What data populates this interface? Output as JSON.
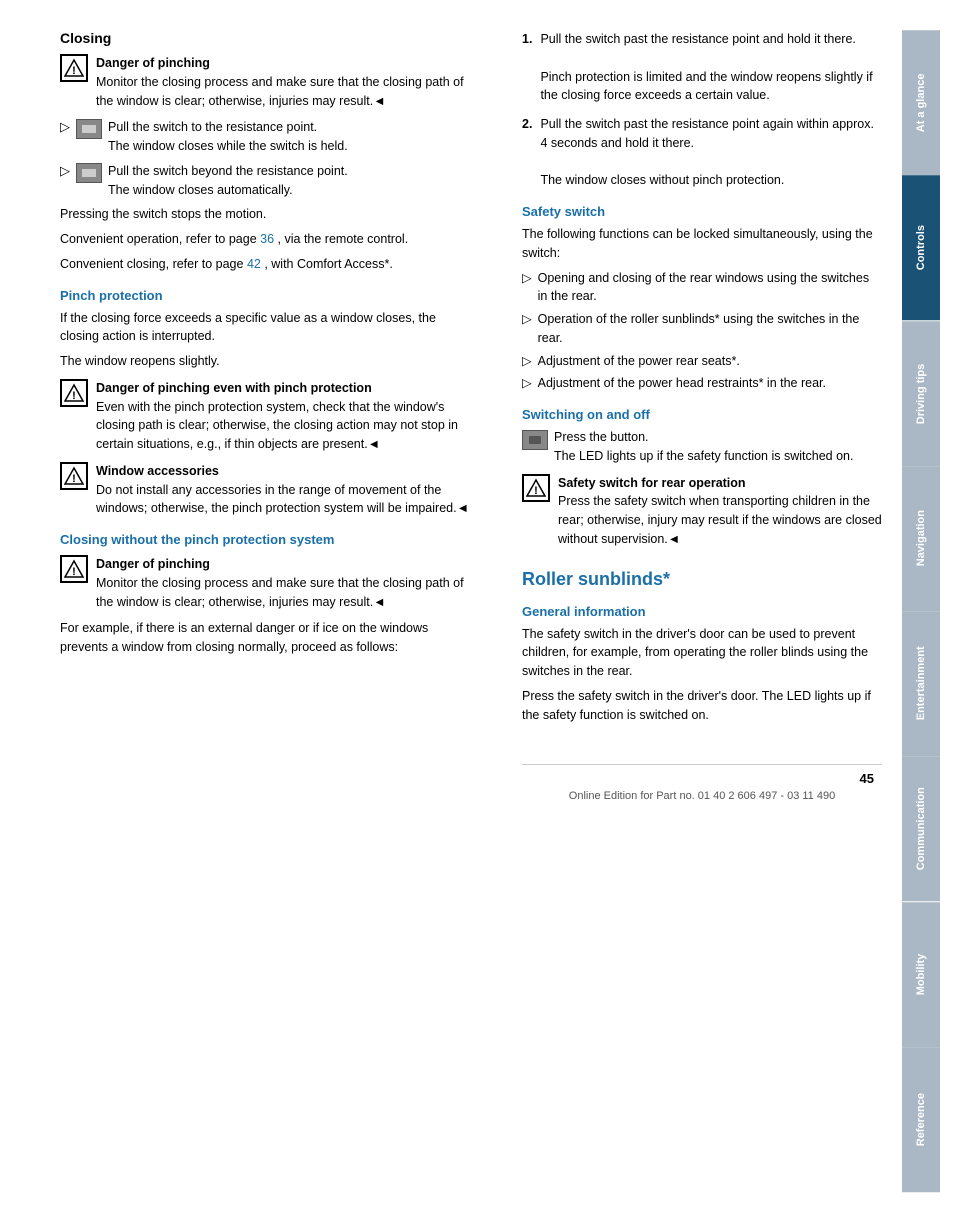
{
  "page": {
    "number": "45",
    "footer": "Online Edition for Part no. 01 40 2 606 497 - 03 11 490"
  },
  "sidebar": {
    "tabs": [
      {
        "label": "At a glance",
        "active": false
      },
      {
        "label": "Controls",
        "active": true
      },
      {
        "label": "Driving tips",
        "active": false
      },
      {
        "label": "Navigation",
        "active": false
      },
      {
        "label": "Entertainment",
        "active": false
      },
      {
        "label": "Communication",
        "active": false
      },
      {
        "label": "Mobility",
        "active": false
      },
      {
        "label": "Reference",
        "active": false
      }
    ]
  },
  "left": {
    "heading": "Closing",
    "warning1": {
      "title": "Danger of pinching",
      "text": "Monitor the closing process and make sure that the closing path of the window is clear; otherwise, injuries may result.◄"
    },
    "instruction1": {
      "text": "Pull the switch to the resistance point.",
      "sub": "The window closes while the switch is held."
    },
    "instruction2": {
      "text": "Pull the switch beyond the resistance point.",
      "sub": "The window closes automatically."
    },
    "press_stop": "Pressing the switch stops the motion.",
    "convenient1": "Convenient operation, refer to page",
    "convenient1_page": "36",
    "convenient1_rest": ", via the remote control.",
    "convenient2": "Convenient closing, refer to page",
    "convenient2_page": "42",
    "convenient2_rest": ", with Comfort Access*.",
    "pinch_heading": "Pinch protection",
    "pinch_p1": "If the closing force exceeds a specific value as a window closes, the closing action is interrupted.",
    "pinch_p2": "The window reopens slightly.",
    "warning2": {
      "title": "Danger of pinching even with pinch protection",
      "text": "Even with the pinch protection system, check that the window's closing path is clear; otherwise, the closing action may not stop in certain situations, e.g., if thin objects are present.◄"
    },
    "warning3": {
      "title": "Window accessories",
      "text": "Do not install any accessories in the range of movement of the windows; otherwise, the pinch protection system will be impaired.◄"
    },
    "closing_without_heading": "Closing without the pinch protection system",
    "warning4": {
      "title": "Danger of pinching",
      "text": "Monitor the closing process and make sure that the closing path of the window is clear; otherwise, injuries may result.◄"
    },
    "closing_without_p1": "For example, if there is an external danger or if ice on the windows prevents a window from closing normally, proceed as follows:"
  },
  "right": {
    "steps": [
      {
        "num": "1.",
        "text": "Pull the switch past the resistance point and hold it there.",
        "note": "Pinch protection is limited and the window reopens slightly if the closing force exceeds a certain value."
      },
      {
        "num": "2.",
        "text": "Pull the switch past the resistance point again within approx. 4 seconds and hold it there.",
        "note": "The window closes without pinch protection."
      }
    ],
    "safety_heading": "Safety switch",
    "safety_p1": "The following functions can be locked simultaneously, using the switch:",
    "safety_items": [
      "Opening and closing of the rear windows using the switches in the rear.",
      "Operation of the roller sunblinds* using the switches in the rear.",
      "Adjustment of the power rear seats*.",
      "Adjustment of the power head restraints* in the rear."
    ],
    "switching_heading": "Switching on and off",
    "switch_instruction": "Press the button.",
    "switch_note": "The LED lights up if the safety function is switched on.",
    "warning5": {
      "title": "Safety switch for rear operation",
      "text": "Press the safety switch when transporting children in the rear; otherwise, injury may result if the windows are closed without supervision.◄"
    },
    "roller_heading": "Roller sunblinds*",
    "general_info_heading": "General information",
    "general_p1": "The safety switch in the driver's door can be used to prevent children, for example, from operating the roller blinds using the switches in the rear.",
    "general_p2": "Press the safety switch in the driver's door. The LED lights up if the safety function is switched on."
  }
}
